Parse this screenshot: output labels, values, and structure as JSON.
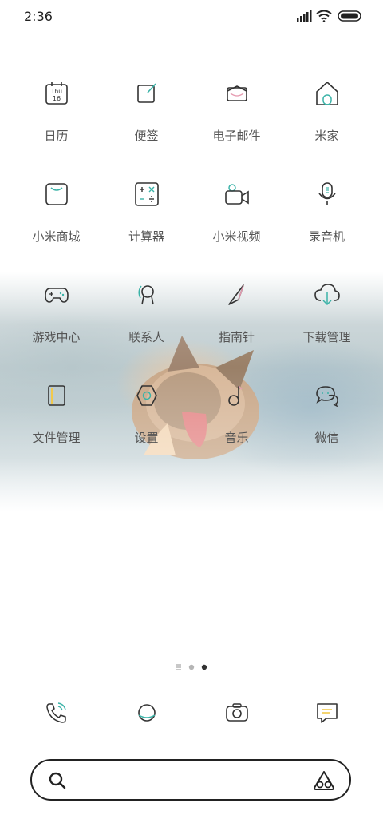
{
  "status_bar": {
    "time": "2:36"
  },
  "apps": [
    {
      "label": "日历",
      "icon": "calendar-icon",
      "icon_text": "Thu",
      "icon_num": "16"
    },
    {
      "label": "便签",
      "icon": "notes-icon"
    },
    {
      "label": "电子邮件",
      "icon": "email-icon"
    },
    {
      "label": "米家",
      "icon": "mi-home-icon"
    },
    {
      "label": "小米商城",
      "icon": "mi-store-icon"
    },
    {
      "label": "计算器",
      "icon": "calculator-icon"
    },
    {
      "label": "小米视频",
      "icon": "video-icon"
    },
    {
      "label": "录音机",
      "icon": "recorder-icon"
    },
    {
      "label": "游戏中心",
      "icon": "gamepad-icon"
    },
    {
      "label": "联系人",
      "icon": "contacts-icon"
    },
    {
      "label": "指南针",
      "icon": "compass-icon"
    },
    {
      "label": "下载管理",
      "icon": "cloud-download-icon"
    },
    {
      "label": "文件管理",
      "icon": "file-manager-icon"
    },
    {
      "label": "设置",
      "icon": "settings-icon"
    },
    {
      "label": "音乐",
      "icon": "music-icon"
    },
    {
      "label": "微信",
      "icon": "wechat-icon"
    }
  ],
  "page_indicator": {
    "total_pages": 2,
    "current_page": 2
  },
  "dock": [
    {
      "icon": "phone-icon"
    },
    {
      "icon": "messages-icon"
    },
    {
      "icon": "camera-icon"
    },
    {
      "icon": "chat-icon"
    }
  ],
  "search": {
    "placeholder": ""
  },
  "colors": {
    "accent_teal": "#3bb3a8",
    "accent_pink": "#e69ab0",
    "accent_yellow": "#f2c94c",
    "line": "#333333"
  }
}
